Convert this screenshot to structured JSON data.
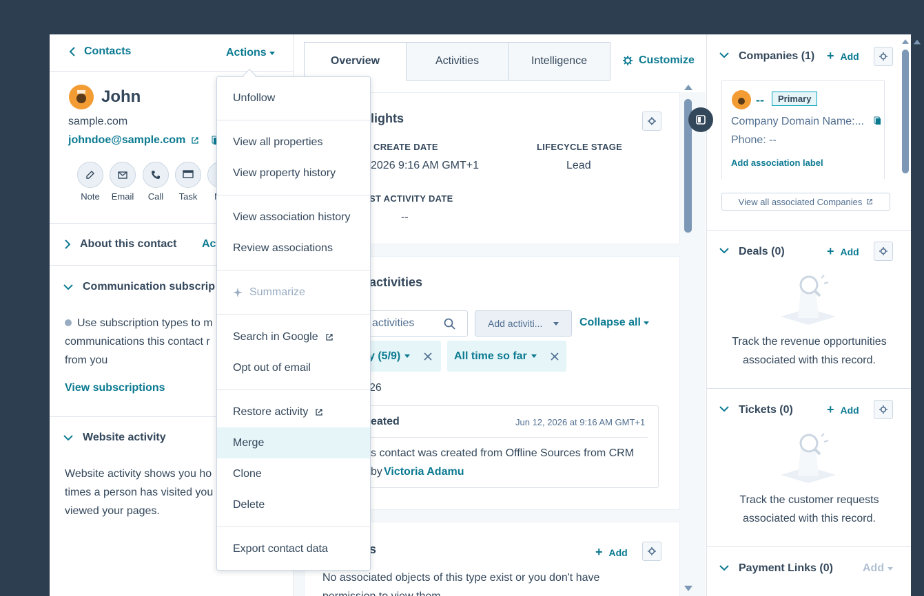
{
  "left": {
    "back_label": "Contacts",
    "actions_label": "Actions",
    "contact_name": "John",
    "domain": "sample.com",
    "email": "johndoe@sample.com",
    "activity_buttons": [
      "Note",
      "Email",
      "Call",
      "Task",
      "Me"
    ],
    "about_title": "About this contact",
    "about_action": "Act",
    "comm_title": "Communication subscrip",
    "comm_body": [
      "Use subscription types to m",
      "communications this contact r",
      "from you"
    ],
    "view_subscriptions": "View subscriptions",
    "website_title": "Website activity",
    "website_body": [
      "Website activity shows you ho",
      "times a person has visited you",
      "viewed your pages."
    ]
  },
  "tabs": [
    "Overview",
    "Activities",
    "Intelligence"
  ],
  "customize_label": "Customize",
  "highlights": {
    "title": "ghlights",
    "create_label": "CREATE DATE",
    "create_value": "2026 9:16 AM GMT+1",
    "lifecycle_label": "LIFECYCLE STAGE",
    "lifecycle_value": "Lead",
    "last_activity_label": "ST ACTIVITY DATE",
    "last_activity_value": "--"
  },
  "recent": {
    "title": "activities",
    "search_placeholder": "activities",
    "add_activity": "Add activiti...",
    "collapse_all": "Collapse all",
    "filter1": "y (5/9)",
    "filter2": "All time so far",
    "date_group": "26",
    "item_title": "eated",
    "item_time": "Jun 12, 2026 at 9:16 AM GMT+1",
    "item_body_1": "s contact was created from Offline Sources from CRM",
    "item_body_2": "by",
    "item_user": "Victoria Adamu"
  },
  "bottom_card": {
    "title": "s",
    "add_label": "Add",
    "body": "No associated objects of this type exist or you don't have",
    "body2": "permission to view them."
  },
  "menu": {
    "items": [
      "Unfollow",
      "View all properties",
      "View property history",
      "View association history",
      "Review associations",
      "Summarize",
      "Search in Google",
      "Opt out of email",
      "Restore activity",
      "Merge",
      "Clone",
      "Delete",
      "Export contact data"
    ],
    "highlighted": "Merge",
    "disabled": "Summarize"
  },
  "right": {
    "companies_title": "Companies (1)",
    "add_label": "Add",
    "company_name": "--",
    "primary_badge": "Primary",
    "domain_line": "Company Domain Name:...",
    "phone_line": "Phone: --",
    "add_assoc_label": "Add association label",
    "view_all_companies": "View all associated Companies",
    "deals_title": "Deals (0)",
    "deals_empty": [
      "Track the revenue opportunities",
      "associated with this record."
    ],
    "tickets_title": "Tickets (0)",
    "tickets_empty": [
      "Track the customer requests",
      "associated with this record."
    ],
    "payment_title": "Payment Links (0)",
    "payment_add": "Add"
  },
  "colors": {
    "accent": "#0b7a91",
    "text": "#33475b",
    "bg": "#2d3e50",
    "highlight": "#e5f5f8"
  }
}
